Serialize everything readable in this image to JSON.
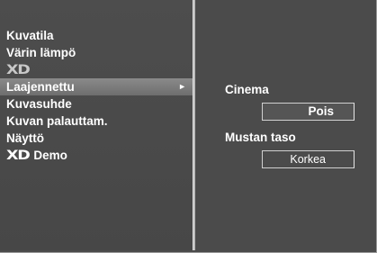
{
  "menu": {
    "items": [
      {
        "label": "Kuvatila"
      },
      {
        "label": "Värin lämpö"
      },
      {
        "label": "XD"
      },
      {
        "label": "Laajennettu",
        "arrow": "►"
      },
      {
        "label": "Kuvasuhde"
      },
      {
        "label": "Kuvan palauttam."
      },
      {
        "label": "Näyttö"
      },
      {
        "logo": "XD",
        "label": "Demo"
      }
    ]
  },
  "submenu": {
    "cinema_label": "Cinema",
    "cinema_value": "Pois",
    "black_level_label": "Mustan taso",
    "black_level_value": "Korkea"
  },
  "colors": {
    "background": "#4b4b4b",
    "divider": "#bcbcbc",
    "text": "#ffffff",
    "highlight": "#7c7c7c"
  }
}
